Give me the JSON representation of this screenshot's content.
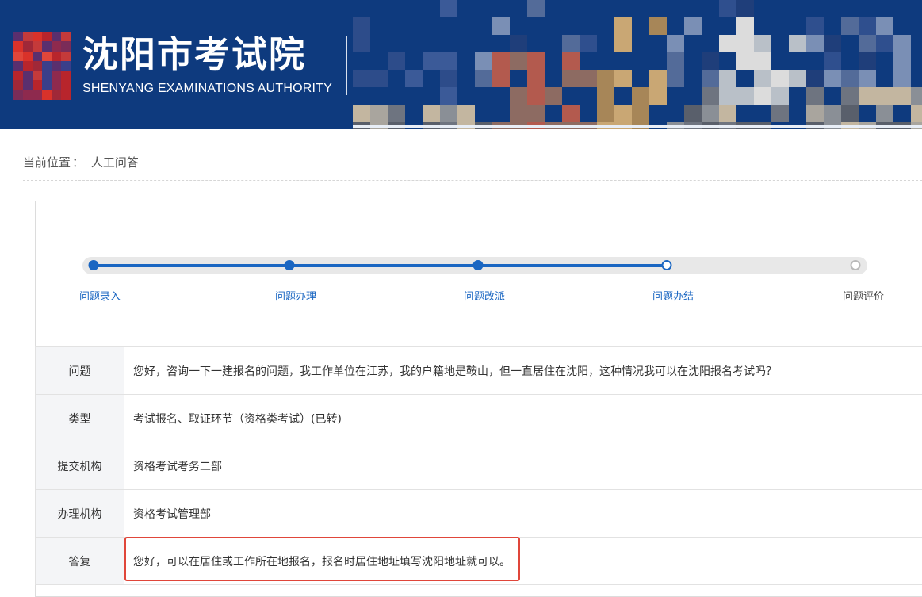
{
  "header": {
    "title": "沈阳市考试院",
    "subtitle": "SHENYANG EXAMINATIONS AUTHORITY",
    "logo_icon": "pixel-logo-icon",
    "colors": {
      "banner": "#0e3a7e",
      "logo_red": "#d9322a"
    }
  },
  "breadcrumb": {
    "label": "当前位置",
    "separator": "：",
    "current": "人工问答"
  },
  "progress": {
    "steps": [
      {
        "label": "问题录入",
        "state": "done"
      },
      {
        "label": "问题办理",
        "state": "done"
      },
      {
        "label": "问题改派",
        "state": "done"
      },
      {
        "label": "问题办结",
        "state": "current"
      },
      {
        "label": "问题评价",
        "state": "pending"
      }
    ],
    "colors": {
      "active": "#1a66c2",
      "track": "#e8e8e8"
    }
  },
  "details": {
    "rows": [
      {
        "key": "问题",
        "value": "您好，咨询一下一建报名的问题，我工作单位在江苏，我的户籍地是鞍山，但一直居住在沈阳，这种情况我可以在沈阳报名考试吗？"
      },
      {
        "key": "类型",
        "value": "考试报名、取证环节（资格类考试）(已转)"
      },
      {
        "key": "提交机构",
        "value": "资格考试考务二部"
      },
      {
        "key": "办理机构",
        "value": "资格考试管理部"
      },
      {
        "key": "答复",
        "value": "您好，可以在居住或工作所在地报名，报名时居住地址填写沈阳地址就可以。"
      }
    ],
    "highlight_color": "#e0463a"
  }
}
